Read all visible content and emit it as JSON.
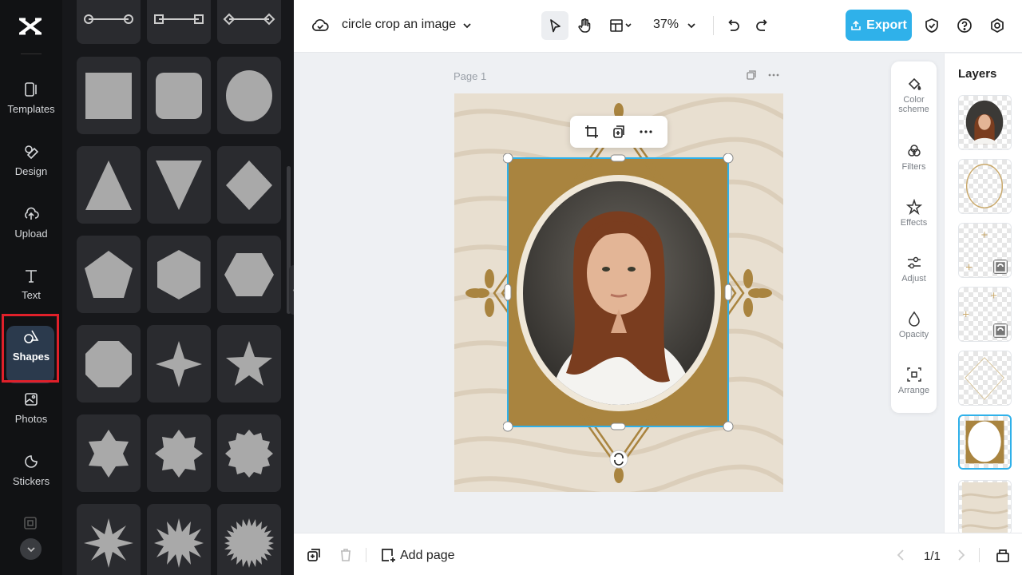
{
  "app": {
    "rail": [
      {
        "label": "Templates",
        "icon": "templates-icon"
      },
      {
        "label": "Design",
        "icon": "design-icon"
      },
      {
        "label": "Upload",
        "icon": "upload-icon"
      },
      {
        "label": "Text",
        "icon": "text-icon"
      },
      {
        "label": "Shapes",
        "icon": "shapes-icon",
        "active": true
      },
      {
        "label": "Photos",
        "icon": "photos-icon"
      },
      {
        "label": "Stickers",
        "icon": "stickers-icon"
      }
    ]
  },
  "shapes": [
    "line-circle-ends",
    "line-square-ends",
    "line-diamond-ends",
    "square",
    "rounded-square",
    "circle",
    "triangle",
    "inverted-triangle",
    "diamond",
    "pentagon",
    "hexagon-vertical",
    "hexagon-horizontal",
    "octagon",
    "four-point-star",
    "five-point-star",
    "six-point-star",
    "eight-point-star",
    "twelve-point-star",
    "starburst-8",
    "starburst-12",
    "starburst-24"
  ],
  "topbar": {
    "title": "circle crop an image",
    "zoom": "37%",
    "export_label": "Export"
  },
  "canvas": {
    "page_label": "Page 1"
  },
  "properties": [
    {
      "label": "Color scheme",
      "icon": "color-scheme-icon"
    },
    {
      "label": "Filters",
      "icon": "filters-icon"
    },
    {
      "label": "Effects",
      "icon": "effects-icon"
    },
    {
      "label": "Adjust",
      "icon": "adjust-icon"
    },
    {
      "label": "Opacity",
      "icon": "opacity-icon"
    },
    {
      "label": "Arrange",
      "icon": "arrange-icon"
    }
  ],
  "layers": {
    "title": "Layers"
  },
  "bottombar": {
    "add_page_label": "Add page",
    "page_count": "1/1"
  },
  "colors": {
    "accent": "#2fb1ea",
    "frame_gold": "#a9843f",
    "sand": "#e8dfd0",
    "highlight_red": "#e0202a"
  }
}
